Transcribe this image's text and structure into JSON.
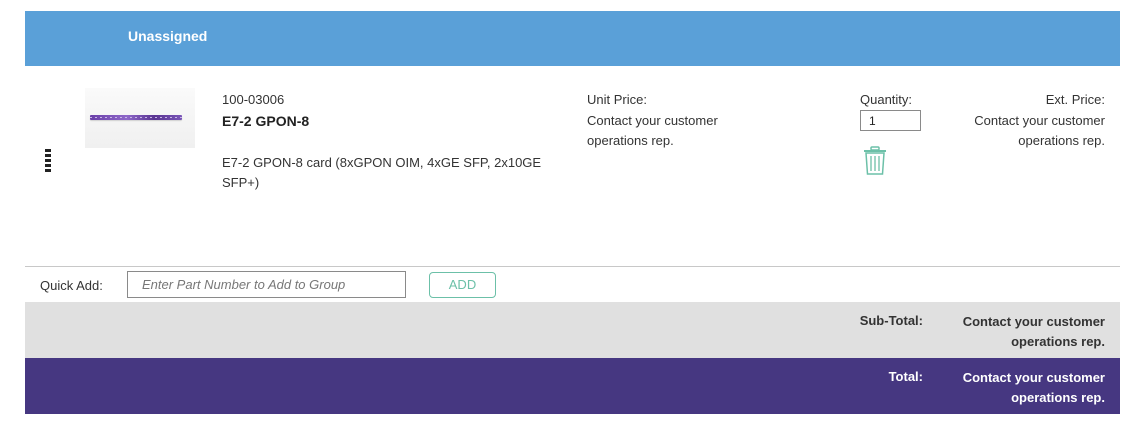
{
  "group": {
    "title": "Unassigned",
    "header_color": "#5aa0d8"
  },
  "item": {
    "drag_icon": "drag-handle-icon",
    "image_alt": "E7-2 GPON-8 card image",
    "part_number": "100-03006",
    "name": "E7-2 GPON-8",
    "description": "E7-2 GPON-8 card (8xGPON OIM, 4xGE SFP, 2x10GE SFP+)",
    "unit_price_label": "Unit Price:",
    "unit_price_value": "Contact your customer operations rep.",
    "quantity_label": "Quantity:",
    "quantity_value": "1",
    "delete_icon": "trash-icon",
    "ext_price_label": "Ext. Price:",
    "ext_price_value": "Contact your customer operations rep."
  },
  "quick_add": {
    "label": "Quick Add:",
    "placeholder": "Enter Part Number to Add to Group",
    "button_label": "ADD",
    "button_color": "#6cc0a8"
  },
  "summary": {
    "subtotal_label": "Sub-Total:",
    "subtotal_value": "Contact your customer operations rep.",
    "total_label": "Total:",
    "total_value": "Contact your customer operations rep.",
    "subtotal_color": "#e0e0e0",
    "total_color": "#463781"
  }
}
